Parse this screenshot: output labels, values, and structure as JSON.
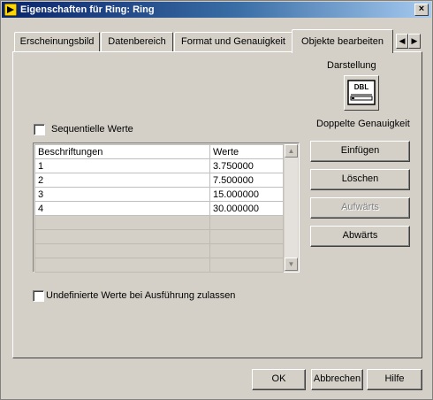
{
  "window": {
    "title": "Eigenschaften für Ring: Ring",
    "close_glyph": "×"
  },
  "tabs": [
    {
      "label": "Erscheinungsbild",
      "active": false
    },
    {
      "label": "Datenbereich",
      "active": false
    },
    {
      "label": "Format und Genauigkeit",
      "active": false
    },
    {
      "label": "Objekte bearbeiten",
      "active": true
    }
  ],
  "tab_scroll": {
    "left": "◀",
    "right": "▶"
  },
  "representation": {
    "heading": "Darstellung",
    "icon_text": "DBL",
    "type_label": "Doppelte Genauigkeit"
  },
  "sequential_values": {
    "label": "Sequentielle Werte",
    "checked": false
  },
  "items_table": {
    "columns": [
      "Beschriftungen",
      "Werte"
    ],
    "rows": [
      {
        "label": "1",
        "value": "3.750000"
      },
      {
        "label": "2",
        "value": "7.500000"
      },
      {
        "label": "3",
        "value": "15.000000"
      },
      {
        "label": "4",
        "value": "30.000000"
      }
    ],
    "scroll_up": "▲",
    "scroll_down": "▼"
  },
  "item_buttons": {
    "insert": "Einfügen",
    "delete": "Löschen",
    "move_up": "Aufwärts",
    "move_down": "Abwärts"
  },
  "undefined_values": {
    "label": "Undefinierte Werte bei Ausführung zulassen",
    "checked": false
  },
  "dialog_buttons": {
    "ok": "OK",
    "cancel": "Abbrechen",
    "help": "Hilfe"
  },
  "colors": {
    "titlebar_start": "#0a246a",
    "titlebar_end": "#a6caf0",
    "face": "#d4d0c8",
    "disabled_text": "#808080"
  }
}
